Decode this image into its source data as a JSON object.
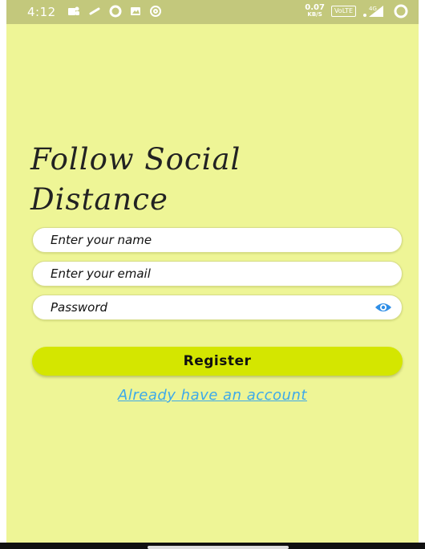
{
  "status_bar": {
    "time": "4:12",
    "net_speed_value": "0.07",
    "net_speed_unit": "KB/S",
    "volte": "VoLTE",
    "network": "4G",
    "left_icons": [
      "teams-icon",
      "link-icon",
      "circle-icon",
      "image-icon",
      "at-icon"
    ]
  },
  "page": {
    "title": "Follow Social Distance",
    "background_color": "#eef596",
    "accent_color": "#d4e600",
    "link_color": "#3da9ea"
  },
  "form": {
    "name_placeholder": "Enter your name",
    "name_value": "",
    "email_placeholder": "Enter your email",
    "email_value": "",
    "password_placeholder": "Password",
    "password_value": "",
    "register_label": "Register",
    "login_link_label": "Already have an account"
  }
}
